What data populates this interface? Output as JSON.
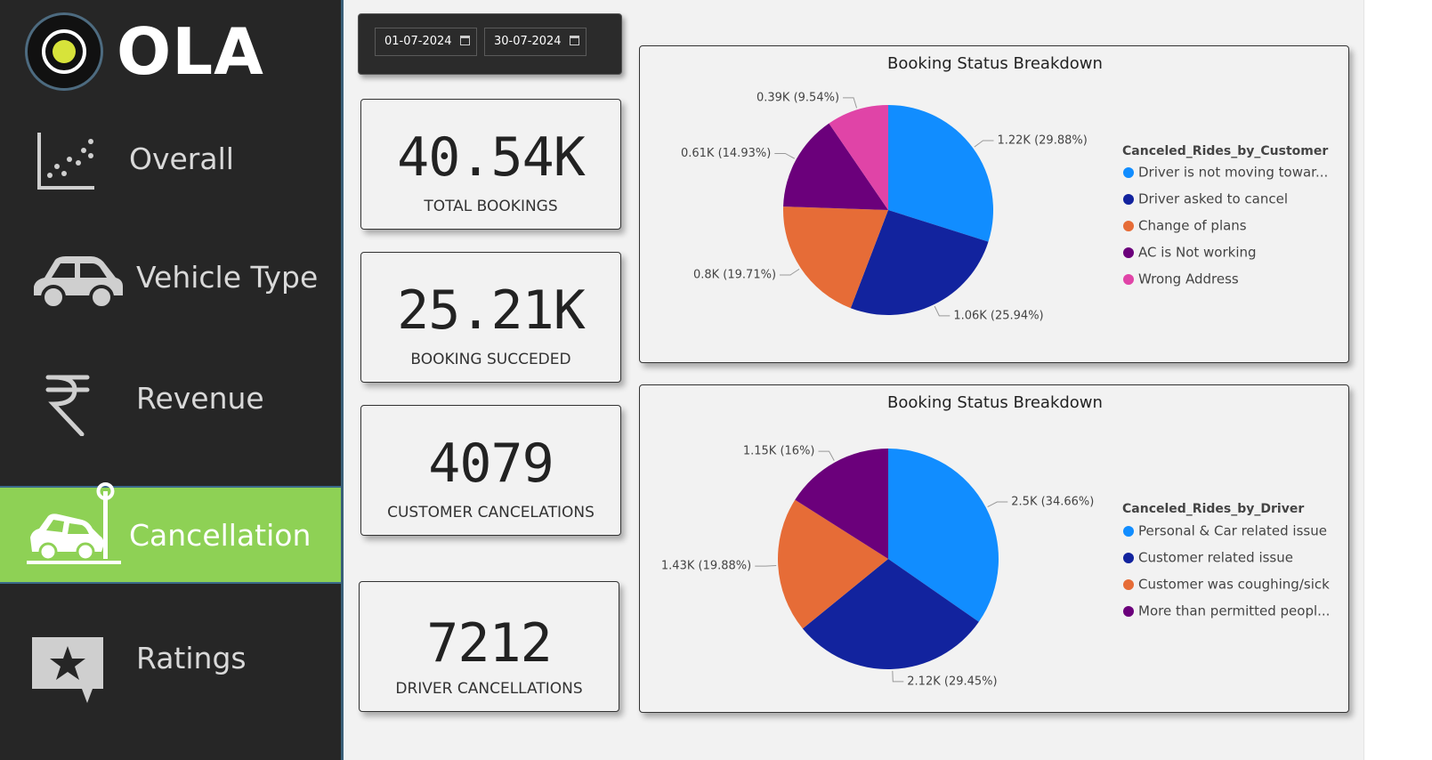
{
  "brand": {
    "name": "OLA",
    "logo_colors": {
      "ring": "#4d6b80",
      "dot": "#d7e33a"
    }
  },
  "nav": {
    "items": [
      {
        "label": "Overall",
        "icon": "scatter-plot-icon",
        "active": false
      },
      {
        "label": "Vehicle Type",
        "icon": "car-icon",
        "active": false
      },
      {
        "label": "Revenue",
        "icon": "rupee-icon",
        "active": false
      },
      {
        "label": "Cancellation",
        "icon": "car-crash-icon",
        "active": true
      },
      {
        "label": "Ratings",
        "icon": "star-speech-bubble-icon",
        "active": false
      }
    ],
    "active_color": "#8ed155"
  },
  "filters": {
    "start_date": "01-07-2024",
    "end_date": "30-07-2024"
  },
  "kpis": [
    {
      "value": "40.54K",
      "label": "TOTAL BOOKINGS"
    },
    {
      "value": "25.21K",
      "label": "BOOKING SUCCEDED"
    },
    {
      "value": "4079",
      "label": "CUSTOMER CANCELATIONS"
    },
    {
      "value": "7212",
      "label": "DRIVER CANCELLATIONS"
    }
  ],
  "chart_data": [
    {
      "type": "pie",
      "title": "Booking Status Breakdown",
      "legend_title": "Canceled_Rides_by_Customer",
      "legend_position": "right",
      "slices": [
        {
          "name": "Driver is not moving towar...",
          "value": 1.22,
          "label": "1.22K (29.88%)",
          "percent": 29.88,
          "color": "#118dff"
        },
        {
          "name": "Driver asked to cancel",
          "value": 1.06,
          "label": "1.06K (25.94%)",
          "percent": 25.94,
          "color": "#12239e"
        },
        {
          "name": "Change of plans",
          "value": 0.8,
          "label": "0.8K (19.71%)",
          "percent": 19.71,
          "color": "#e66c37"
        },
        {
          "name": "AC is Not working",
          "value": 0.61,
          "label": "0.61K (14.93%)",
          "percent": 14.93,
          "color": "#6b007b"
        },
        {
          "name": "Wrong Address",
          "value": 0.39,
          "label": "0.39K (9.54%)",
          "percent": 9.54,
          "color": "#e044a7"
        }
      ]
    },
    {
      "type": "pie",
      "title": "Booking Status Breakdown",
      "legend_title": "Canceled_Rides_by_Driver",
      "legend_position": "right",
      "slices": [
        {
          "name": "Personal & Car related issue",
          "value": 2.5,
          "label": "2.5K (34.66%)",
          "percent": 34.66,
          "color": "#118dff"
        },
        {
          "name": "Customer related issue",
          "value": 2.12,
          "label": "2.12K (29.45%)",
          "percent": 29.45,
          "color": "#12239e"
        },
        {
          "name": "Customer was coughing/sick",
          "value": 1.43,
          "label": "1.43K (19.88%)",
          "percent": 19.88,
          "color": "#e66c37"
        },
        {
          "name": "More than permitted peopl...",
          "value": 1.15,
          "label": "1.15K (16%)",
          "percent": 16,
          "color": "#6b007b"
        }
      ]
    }
  ]
}
